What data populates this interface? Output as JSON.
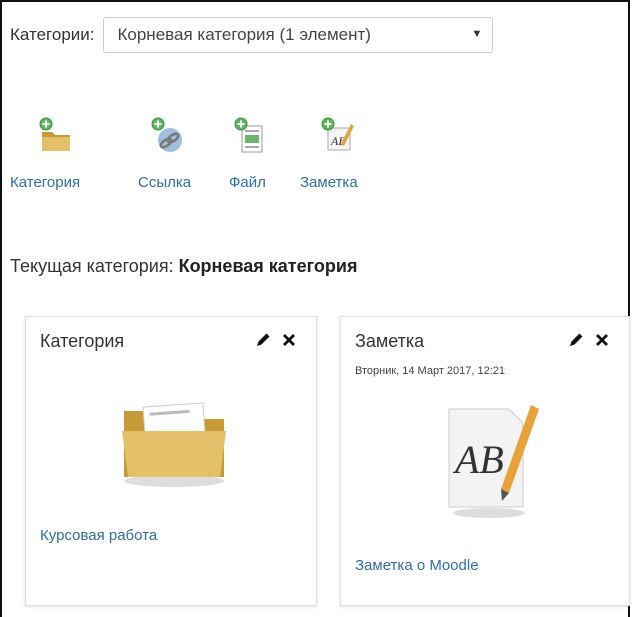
{
  "header": {
    "category_label": "Категории:",
    "category_select_value": "Корневая категория (1 элемент)"
  },
  "toolbar": {
    "items": [
      {
        "label": "Категория",
        "icon": "add-folder-icon"
      },
      {
        "label": "Ссылка",
        "icon": "add-link-icon"
      },
      {
        "label": "Файл",
        "icon": "add-file-icon"
      },
      {
        "label": "Заметка",
        "icon": "add-note-icon"
      }
    ]
  },
  "current": {
    "prefix": "Текущая категория: ",
    "name": "Корневая категория"
  },
  "cards": [
    {
      "title": "Категория",
      "link": "Курсовая работа",
      "icon": "folder-icon"
    },
    {
      "title": "Заметка",
      "date": "Вторник, 14 Март 2017, 12:21",
      "link": "Заметка о Moodle",
      "icon": "note-icon"
    }
  ],
  "colors": {
    "link": "#2f6fa8",
    "add_green": "#5cb85c",
    "folder": "#d9b45a"
  }
}
